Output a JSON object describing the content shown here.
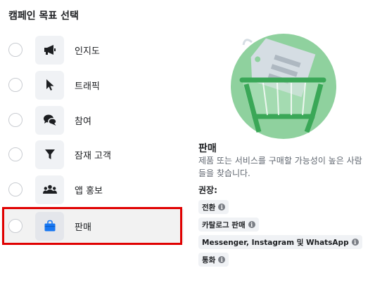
{
  "header": {
    "title": "캠페인 목표 선택"
  },
  "objectives": [
    {
      "id": "awareness",
      "label": "인지도",
      "icon": "megaphone-icon"
    },
    {
      "id": "traffic",
      "label": "트래픽",
      "icon": "cursor-icon"
    },
    {
      "id": "engagement",
      "label": "참여",
      "icon": "chat-bubbles-icon"
    },
    {
      "id": "leads",
      "label": "잠재 고객",
      "icon": "funnel-icon"
    },
    {
      "id": "app_promotion",
      "label": "앱 홍보",
      "icon": "people-group-icon"
    },
    {
      "id": "sales",
      "label": "판매",
      "icon": "shopping-bag-icon",
      "selected": true
    }
  ],
  "detail": {
    "title": "판매",
    "description": "제품 또는 서비스를 구매할 가능성이 높은 사람들을 찾습니다.",
    "recommended_label": "권장:",
    "chips": [
      "전환",
      "카탈로그 판매",
      "Messenger, Instagram 및 WhatsApp",
      "통화"
    ],
    "illustration": "shopping-cart-price-tag-illustration"
  },
  "colors": {
    "accent_blue": "#1877f2",
    "illus_green": "#8fd19e",
    "illus_dark": "#3aa757",
    "highlight_red": "#e00000"
  }
}
